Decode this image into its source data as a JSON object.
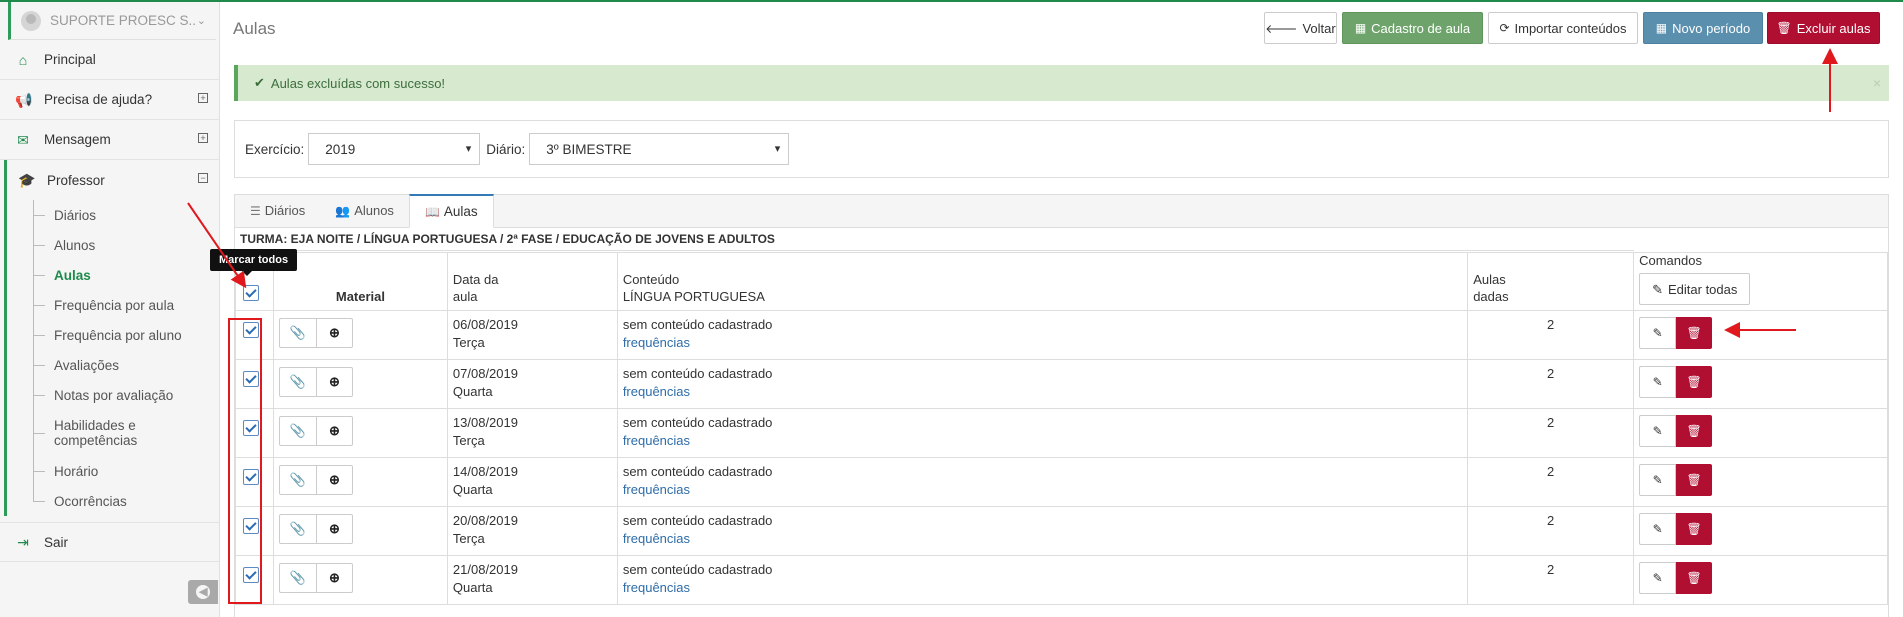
{
  "user": {
    "name": "SUPORTE PROESC S..."
  },
  "sidebar": {
    "items": [
      {
        "label": "Principal",
        "icon": "home-icon"
      },
      {
        "label": "Precisa de ajuda?",
        "icon": "megaphone-icon"
      },
      {
        "label": "Mensagem",
        "icon": "envelope-icon"
      },
      {
        "label": "Professor",
        "icon": "graduation-cap-icon"
      }
    ],
    "professor_sub": [
      "Diários",
      "Alunos",
      "Aulas",
      "Frequência por aula",
      "Frequência por aluno",
      "Avaliações",
      "Notas por avaliação",
      "Habilidades e competências",
      "Horário",
      "Ocorrências"
    ],
    "sair": "Sair",
    "active_sub": "Aulas"
  },
  "header": {
    "title": "Aulas",
    "buttons": {
      "voltar": "Voltar",
      "cadastro": "Cadastro de aula",
      "importar": "Importar conteúdos",
      "novo": "Novo período",
      "excluir": "Excluir aulas"
    }
  },
  "alert": {
    "message": "Aulas excluídas com sucesso!"
  },
  "filter": {
    "exercicio_label": "Exercício:",
    "exercicio_value": "2019",
    "diario_label": "Diário:",
    "diario_value": "3º BIMESTRE"
  },
  "tabs": [
    "Diários",
    "Alunos",
    "Aulas"
  ],
  "turma": "TURMA: EJA NOITE / LÍNGUA PORTUGUESA / 2ª FASE / EDUCAÇÃO DE JOVENS E ADULTOS",
  "table": {
    "headers": {
      "material": "Material",
      "data_1": "Data da",
      "data_2": "aula",
      "conteudo_1": "Conteúdo",
      "conteudo_2": "LÍNGUA PORTUGUESA",
      "aulas_1": "Aulas",
      "aulas_2": "dadas",
      "comandos": "Comandos",
      "editar_todas": "Editar todas"
    },
    "rows": [
      {
        "date": "06/08/2019",
        "day": "Terça",
        "content": "sem conteúdo cadastrado",
        "link": "frequências",
        "count": "2"
      },
      {
        "date": "07/08/2019",
        "day": "Quarta",
        "content": "sem conteúdo cadastrado",
        "link": "frequências",
        "count": "2"
      },
      {
        "date": "13/08/2019",
        "day": "Terça",
        "content": "sem conteúdo cadastrado",
        "link": "frequências",
        "count": "2"
      },
      {
        "date": "14/08/2019",
        "day": "Quarta",
        "content": "sem conteúdo cadastrado",
        "link": "frequências",
        "count": "2"
      },
      {
        "date": "20/08/2019",
        "day": "Terça",
        "content": "sem conteúdo cadastrado",
        "link": "frequências",
        "count": "2"
      },
      {
        "date": "21/08/2019",
        "day": "Quarta",
        "content": "sem conteúdo cadastrado",
        "link": "frequências",
        "count": "2"
      }
    ]
  },
  "tooltip": "Marcar todos",
  "colors": {
    "accent_green": "#1f8a4c",
    "danger": "#b00f32",
    "annotation_red": "#e0191e"
  }
}
